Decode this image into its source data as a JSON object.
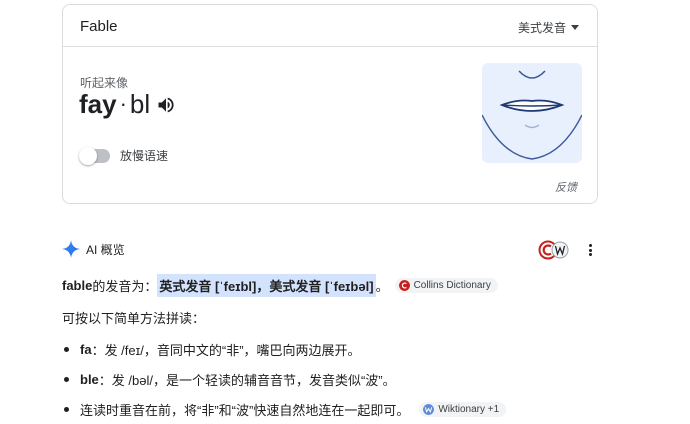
{
  "card": {
    "title": "Fable",
    "accent_select": "美式发音",
    "sounds_like_label": "听起来像",
    "pron_stressed": "fay",
    "pron_separator": "·",
    "pron_unstressed": "bl",
    "slow_speed_label": "放慢语速",
    "slow_speed_on": false,
    "feedback_label": "反馈"
  },
  "ai_overview": {
    "label": "AI 概览",
    "line1": {
      "word": "fable",
      "text_mid": " 的发音为：",
      "highlight": "英式发音 [ˈfeɪbl]，美式发音 [ˈfeɪbəl]",
      "end": "。",
      "citation": "Collins Dictionary"
    },
    "line2": "可按以下简单方法拼读：",
    "bullets": [
      {
        "term": "fa",
        "text": "：发 /feɪ/，音同中文的“非”，嘴巴向两边展开。"
      },
      {
        "term": "ble",
        "text": "：发 /bəl/，是一个轻读的辅音音节，发音类似“波”。"
      },
      {
        "term": "",
        "text": "连读时重音在前，将“非”和“波”快速自然地连在一起即可。",
        "citation": "Wiktionary +1"
      }
    ]
  },
  "colors": {
    "highlight": "#d3e3fd",
    "mouth_bg": "#e8f0fe",
    "gemini_blue": "#4285f4"
  }
}
